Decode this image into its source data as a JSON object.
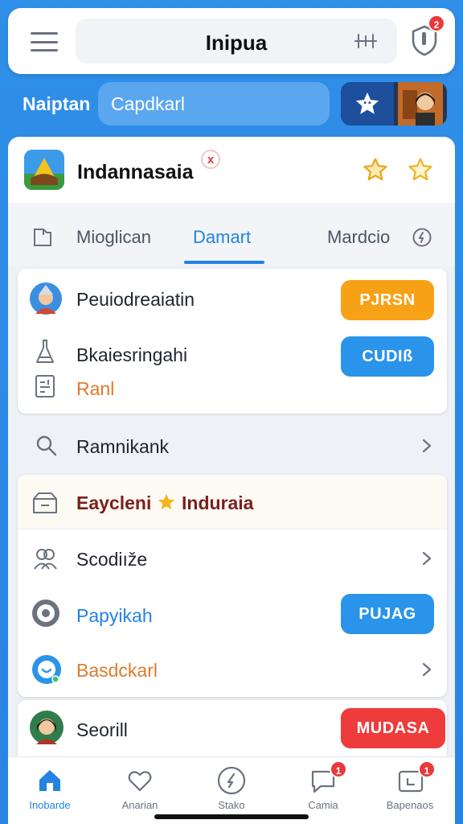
{
  "topbar": {
    "title": "Inipua",
    "notification_count": "2"
  },
  "search": {
    "label": "Naiptan",
    "placeholder": "Capdkarl"
  },
  "app": {
    "name": "Indannasaia",
    "close_symbol": "x"
  },
  "tabs": [
    {
      "label": "Mioglican",
      "active": false
    },
    {
      "label": "Damart",
      "active": true
    },
    {
      "label": "Mardcio",
      "active": false
    }
  ],
  "card1": {
    "row1_label": "Peuiodreaiatin",
    "row1_button": "PJRSN",
    "row2_label": "Bkaiesringahi",
    "row2_button": "CUDIß",
    "row3_label": "Ranl"
  },
  "search_row": {
    "label": "Ramnikank"
  },
  "card2": {
    "header_left": "Eaycleni",
    "header_right": "Induraia",
    "row1_label": "Scodiıže",
    "row2_label": "Papyikah",
    "row2_button": "PUJAG",
    "row3_label": "Basdckarl"
  },
  "card3": {
    "row_label": "Seorill",
    "button": "MUDASA"
  },
  "bottom_nav": [
    {
      "label": "Inobarde",
      "icon": "home-icon",
      "active": true
    },
    {
      "label": "Anarian",
      "icon": "heart-icon",
      "active": false
    },
    {
      "label": "Stako",
      "icon": "compass-icon",
      "active": false
    },
    {
      "label": "Camia",
      "icon": "chat-icon",
      "active": false,
      "badge": "1"
    },
    {
      "label": "Bapenaos",
      "icon": "tv-icon",
      "active": false,
      "badge": "1"
    }
  ],
  "colors": {
    "primary": "#2283e2",
    "orange_button": "#f7a116",
    "blue_button": "#2a93ea",
    "red_button": "#ee3b3b",
    "badge_red": "#e83a3a"
  }
}
